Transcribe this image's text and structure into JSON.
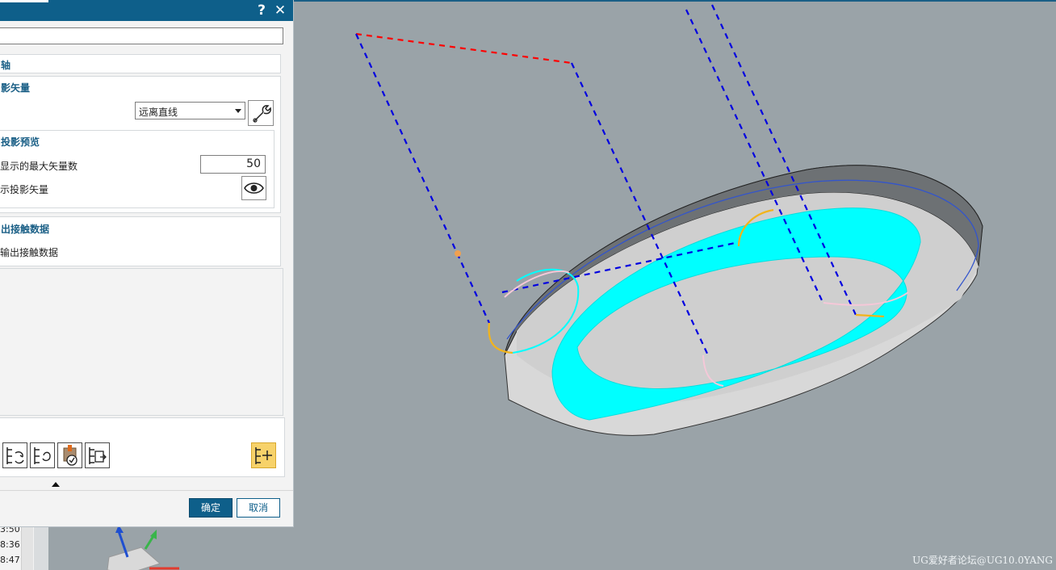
{
  "dialog": {
    "help_symbol": "?",
    "close_symbol": "✕",
    "name_value": "",
    "group_axis_label": "轴",
    "group_projection_vector_label": "影矢量",
    "projection_dropdown_value": "远离直线",
    "group_preview_label": "投影预览",
    "max_vectors_label": "显示的最大矢量数",
    "max_vectors_value": "50",
    "show_vectors_label": "示投影矢量",
    "group_contact_data_label": "出接触数据",
    "contact_data_label": "输出接触数据",
    "ok_label": "确定",
    "cancel_label": "取消"
  },
  "toolbar": {
    "icons": [
      "replay-path-icon",
      "regenerate-path-icon",
      "verify-icon",
      "list-icon",
      "generate-operation-icon"
    ]
  },
  "nav": {
    "times": [
      "3:50",
      "8:36",
      "8:47"
    ]
  },
  "watermark": "UG爱好者论坛@UG10.0YANG",
  "colors": {
    "titlebar": "#0e5f8a",
    "viewport_bg": "#9aa3a8",
    "toolpath": "#00ffff",
    "vector_lines": "#0000e0",
    "red_line": "#ff0000"
  }
}
